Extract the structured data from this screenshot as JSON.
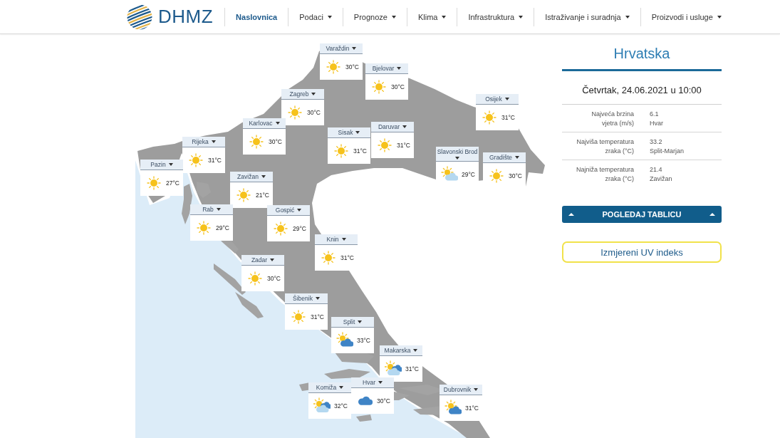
{
  "header": {
    "logo": {
      "text": "DHMZ"
    },
    "nav": [
      {
        "label": "Naslovnica",
        "selected": true,
        "dropdown": false
      },
      {
        "label": "Podaci",
        "selected": false,
        "dropdown": true
      },
      {
        "label": "Prognoze",
        "selected": false,
        "dropdown": true
      },
      {
        "label": "Klima",
        "selected": false,
        "dropdown": true
      },
      {
        "label": "Infrastruktura",
        "selected": false,
        "dropdown": true
      },
      {
        "label": "Istraživanje i suradnja",
        "selected": false,
        "dropdown": true
      },
      {
        "label": "Proizvodi i usluge",
        "selected": false,
        "dropdown": true
      }
    ]
  },
  "map": {
    "stations": [
      {
        "name": "Varaždin",
        "kind": "sunny",
        "temperature": "30°C"
      },
      {
        "name": "Bjelovar",
        "kind": "sunny",
        "temperature": "30°C"
      },
      {
        "name": "Zagreb",
        "kind": "sunny",
        "temperature": "30°C"
      },
      {
        "name": "Karlovac",
        "kind": "sunny",
        "temperature": "30°C"
      },
      {
        "name": "Osijek",
        "kind": "sunny",
        "temperature": "31°C"
      },
      {
        "name": "Sisak",
        "kind": "sunny",
        "temperature": "31°C"
      },
      {
        "name": "Daruvar",
        "kind": "sunny",
        "temperature": "31°C"
      },
      {
        "name": "Rijeka",
        "kind": "sunny",
        "temperature": "31°C"
      },
      {
        "name": "Pazin",
        "kind": "sunny",
        "temperature": "27°C"
      },
      {
        "name": "Slavonski Brod",
        "kind": "fair",
        "temperature": "29°C"
      },
      {
        "name": "Gradište",
        "kind": "sunny",
        "temperature": "30°C"
      },
      {
        "name": "Zavižan",
        "kind": "sunny",
        "temperature": "21°C"
      },
      {
        "name": "Rab",
        "kind": "sunny",
        "temperature": "29°C"
      },
      {
        "name": "Gospić",
        "kind": "sunny",
        "temperature": "29°C"
      },
      {
        "name": "Knin",
        "kind": "sunny",
        "temperature": "31°C"
      },
      {
        "name": "Zadar",
        "kind": "sunny",
        "temperature": "30°C"
      },
      {
        "name": "Šibenik",
        "kind": "sunny",
        "temperature": "31°C"
      },
      {
        "name": "Split",
        "kind": "partly",
        "temperature": "33°C"
      },
      {
        "name": "Makarska",
        "kind": "variable",
        "temperature": "31°C"
      },
      {
        "name": "Komiža",
        "kind": "variable",
        "temperature": "32°C"
      },
      {
        "name": "Hvar",
        "kind": "cloudy",
        "temperature": "30°C"
      },
      {
        "name": "Dubrovnik",
        "kind": "partly",
        "temperature": "31°C"
      }
    ]
  },
  "summary": {
    "title": "Hrvatska",
    "datetime": "Četvrtak, 24.06.2021 u 10:00",
    "rows": [
      {
        "label": [
          "Najveća brzina",
          "vjetra (m/s)"
        ],
        "value": "6.1",
        "station": "Hvar"
      },
      {
        "label": [
          "Najviša temperatura",
          "zraka (°C)"
        ],
        "value": "33.2",
        "station": "Split-Marjan"
      },
      {
        "label": [
          "Najniža temperatura",
          "zraka (°C)"
        ],
        "value": "21.4",
        "station": "Zavižan"
      }
    ],
    "table_button": "POGLEDAJ TABLICU",
    "uv_button": "Izmjereni UV indeks"
  }
}
